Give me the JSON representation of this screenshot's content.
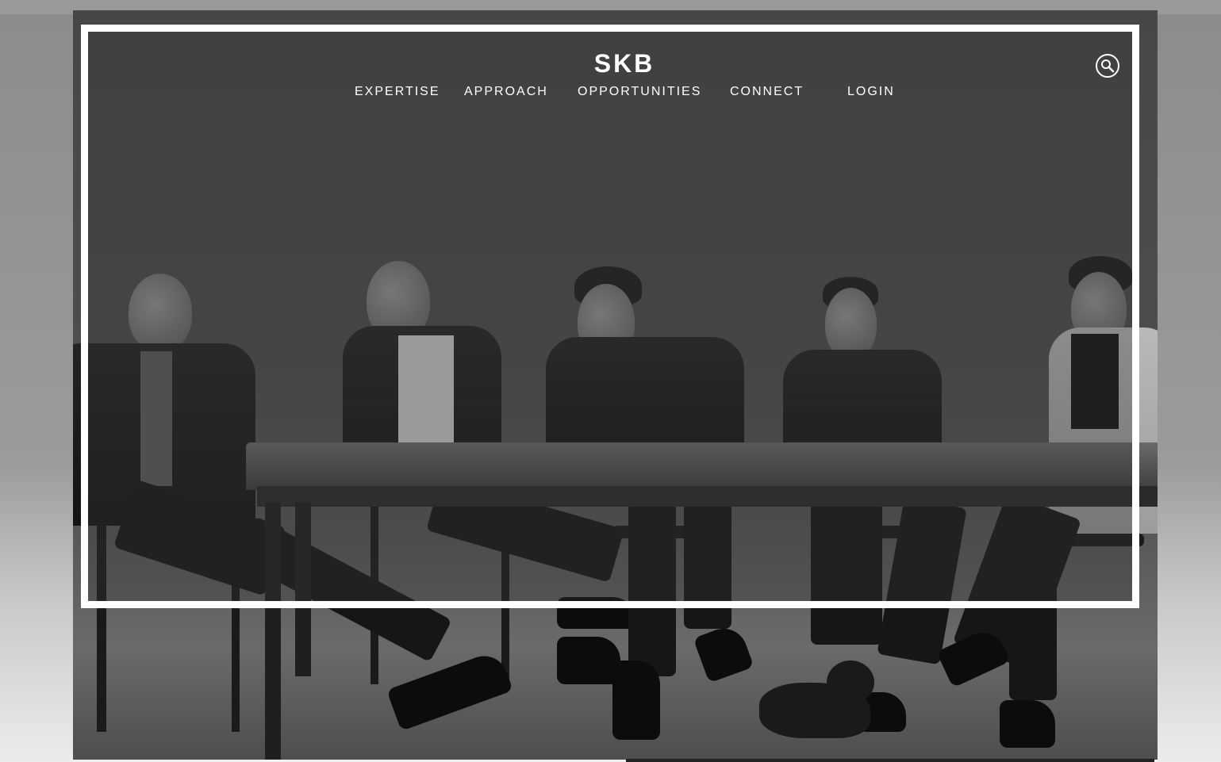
{
  "header": {
    "logo_text": "SKB",
    "search_icon": "search-icon"
  },
  "nav": {
    "items": [
      {
        "label": "EXPERTISE"
      },
      {
        "label": "APPROACH"
      },
      {
        "label": "OPPORTUNITIES"
      },
      {
        "label": "CONNECT"
      },
      {
        "label": "LOGIN"
      }
    ]
  },
  "hero": {
    "image_content": "hero-photo"
  },
  "colors": {
    "frame": "#ffffff",
    "overlay": "#474747",
    "nav_text": "#ffffff"
  }
}
